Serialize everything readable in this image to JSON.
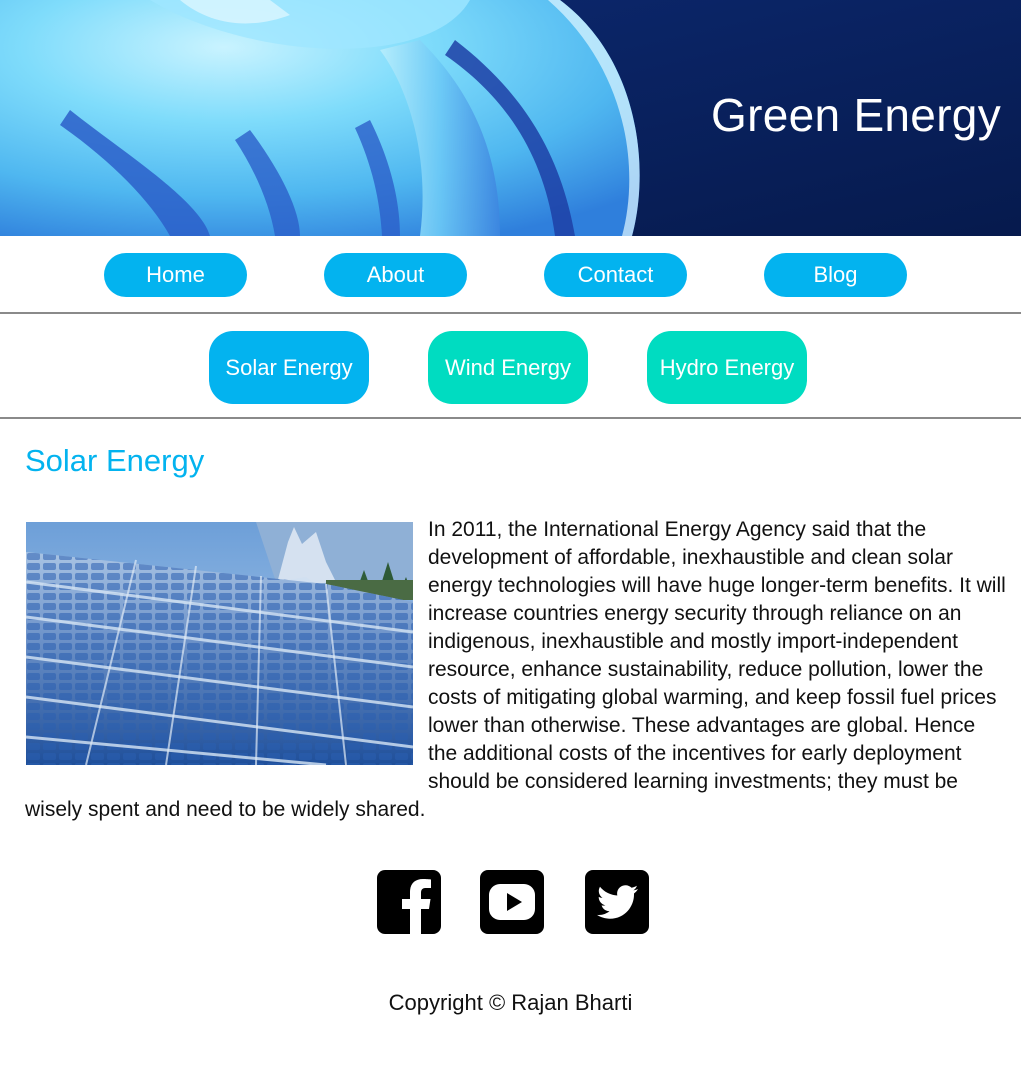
{
  "header": {
    "title": "Green Energy"
  },
  "main_nav": {
    "items": [
      {
        "label": "Home"
      },
      {
        "label": "About"
      },
      {
        "label": "Contact"
      },
      {
        "label": "Blog"
      }
    ]
  },
  "sub_nav": {
    "items": [
      {
        "label": "Solar Energy",
        "active": true
      },
      {
        "label": "Wind Energy",
        "active": false
      },
      {
        "label": "Hydro Energy",
        "active": false
      }
    ]
  },
  "article": {
    "heading": "Solar Energy",
    "image_icon": "solar-panel-photo",
    "body": "In 2011, the International Energy Agency said that the development of affordable, inexhaustible and clean solar energy technologies will have huge longer-term benefits. It will increase countries energy security through reliance on an indigenous, inexhaustible and mostly import-independent resource, enhance sustainability, reduce pollution, lower the costs of mitigating global warming, and keep fossil fuel prices lower than otherwise. These advantages are global. Hence the additional costs of the incentives for early deployment should be considered learning investments; they must be wisely spent and need to be widely shared."
  },
  "social": {
    "icons": [
      "facebook-icon",
      "youtube-icon",
      "twitter-icon"
    ]
  },
  "footer": {
    "copyright": "Copyright © Rajan Bharti"
  },
  "colors": {
    "accent_blue": "#03b3ef",
    "accent_teal": "#00dcc1",
    "banner_navy": "#0b1f5a"
  }
}
